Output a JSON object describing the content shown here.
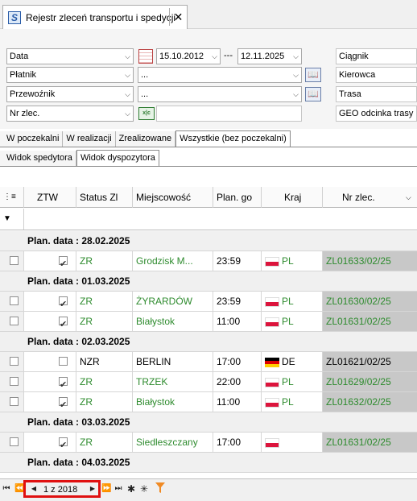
{
  "window": {
    "tab_title": "Rejestr zleceń transportu i spedycji",
    "close_glyph": "✕",
    "app_icon_letter": "S"
  },
  "filters": {
    "date_type": "Data",
    "date_from": "15.10.2012",
    "date_separator": "---",
    "date_to": "12.11.2025",
    "payer_label": "Płatnik",
    "payer_value": "...",
    "carrier_label": "Przewoźnik",
    "carrier_value": "...",
    "order_no_label": "Nr zlec.",
    "right": [
      "Ciągnik",
      "Kierowca",
      "Trasa",
      "GEO odcinka trasy"
    ]
  },
  "status_tabs": [
    "W poczekalni",
    "W realizacji",
    "Zrealizowane",
    "Wszystkie (bez poczekalni)"
  ],
  "active_status_tab": 3,
  "view_tabs": [
    "Widok spedytora",
    "Widok dyspozytora"
  ],
  "active_view_tab": 1,
  "grid": {
    "columns": [
      "ZTW",
      "Status Zl",
      "Miejscowość",
      "Plan. go",
      "Kraj",
      "Nr zlec."
    ],
    "groups": [
      {
        "label": "Plan. data : 28.02.2025",
        "rows": [
          {
            "ztw": true,
            "status": "ZR",
            "city": "Grodzisk M...",
            "time": "23:59",
            "country": "PL",
            "order": "ZL01633/02/25",
            "green": true
          }
        ]
      },
      {
        "label": "Plan. data : 01.03.2025",
        "rows": [
          {
            "ztw": true,
            "status": "ZR",
            "city": "ŻYRARDÓW",
            "time": "23:59",
            "country": "PL",
            "order": "ZL01630/02/25",
            "green": true
          },
          {
            "ztw": true,
            "status": "ZR",
            "city": "Białystok",
            "time": "11:00",
            "country": "PL",
            "order": "ZL01631/02/25",
            "green": true
          }
        ]
      },
      {
        "label": "Plan. data : 02.03.2025",
        "rows": [
          {
            "ztw": false,
            "status": "NZR",
            "city": "BERLIN",
            "time": "17:00",
            "country": "DE",
            "order": "ZL01621/02/25",
            "green": false
          },
          {
            "ztw": true,
            "status": "ZR",
            "city": "TRZEK",
            "time": "22:00",
            "country": "PL",
            "order": "ZL01629/02/25",
            "green": true
          },
          {
            "ztw": true,
            "status": "ZR",
            "city": "Białystok",
            "time": "11:00",
            "country": "PL",
            "order": "ZL01632/02/25",
            "green": true
          }
        ]
      },
      {
        "label": "Plan. data : 03.03.2025",
        "rows": [
          {
            "ztw": true,
            "status": "ZR",
            "city": "Siedleszczany",
            "time": "17:00",
            "country": "",
            "order": "ZL01631/02/25",
            "green": true
          }
        ]
      },
      {
        "label": "Plan. data : 04.03.2025",
        "rows": []
      }
    ]
  },
  "pager": {
    "label": "1 z 2018"
  }
}
